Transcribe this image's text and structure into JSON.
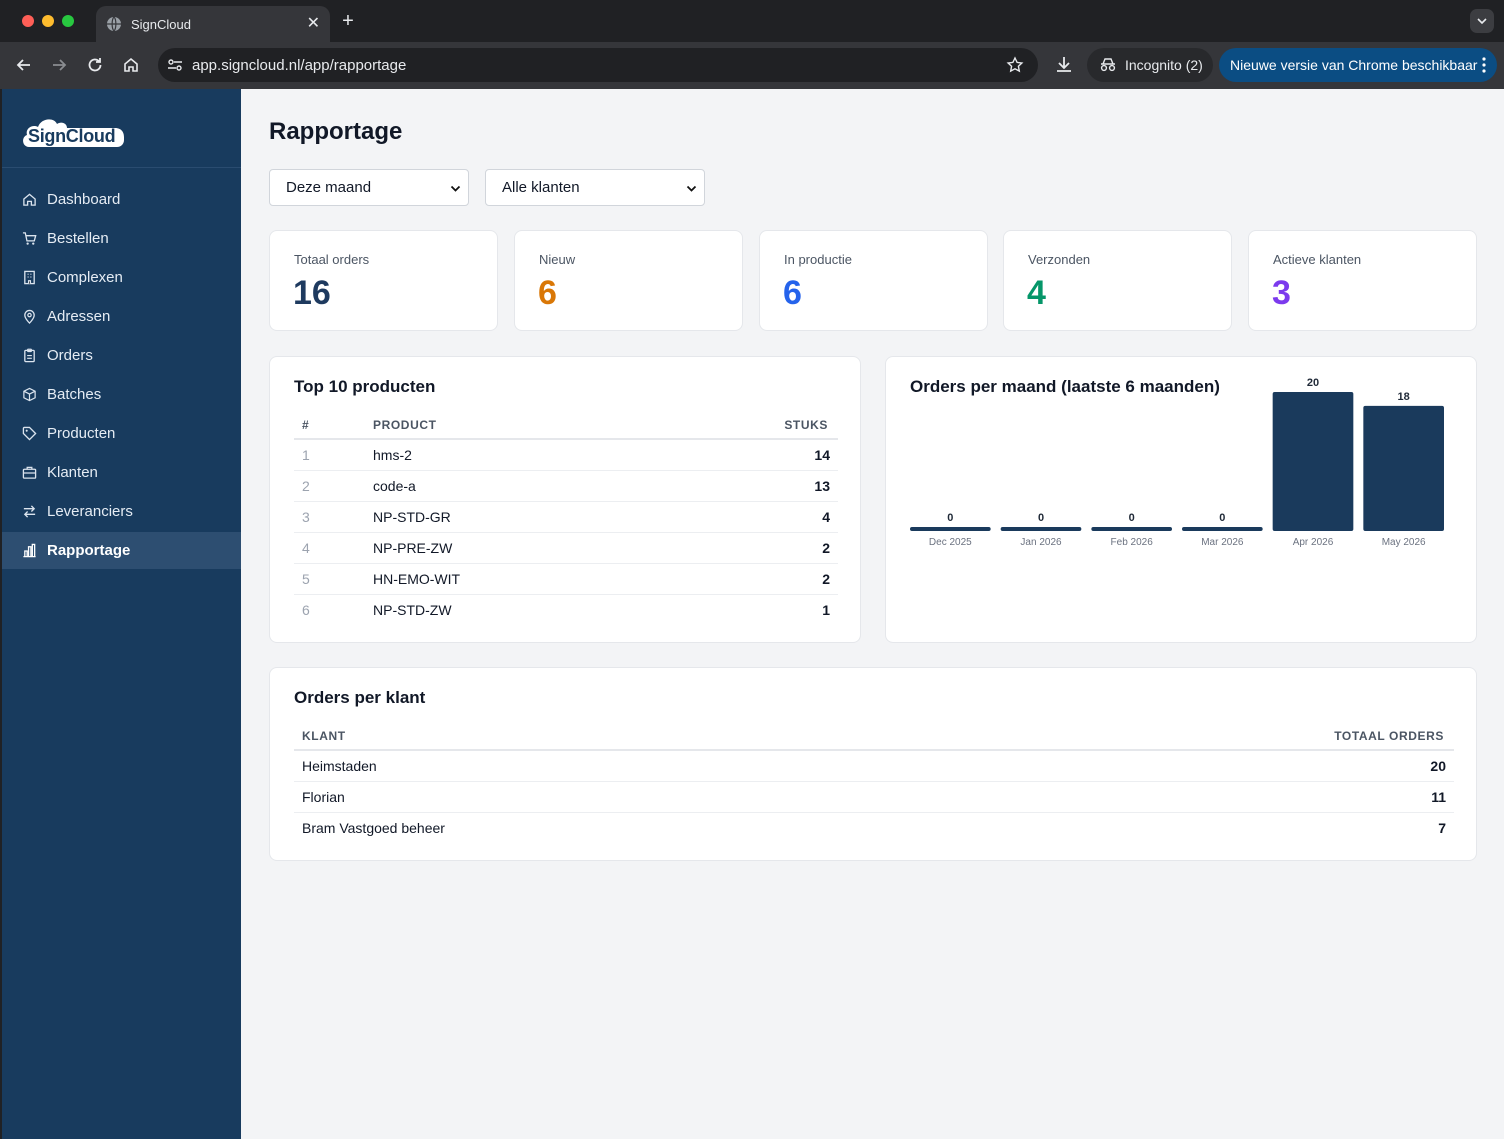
{
  "browser": {
    "tab_title": "SignCloud",
    "url": "app.signcloud.nl/app/rapportage",
    "incognito_label": "Incognito (2)",
    "update_label": "Nieuwe versie van Chrome beschikbaar"
  },
  "sidebar": {
    "logo_text": "SignCloud",
    "items": [
      {
        "label": "Dashboard",
        "icon": "home-icon"
      },
      {
        "label": "Bestellen",
        "icon": "cart-icon"
      },
      {
        "label": "Complexen",
        "icon": "building-icon"
      },
      {
        "label": "Adressen",
        "icon": "map-pin-icon"
      },
      {
        "label": "Orders",
        "icon": "clipboard-icon"
      },
      {
        "label": "Batches",
        "icon": "box-icon"
      },
      {
        "label": "Producten",
        "icon": "tag-icon"
      },
      {
        "label": "Klanten",
        "icon": "briefcase-icon"
      },
      {
        "label": "Leveranciers",
        "icon": "swap-icon"
      },
      {
        "label": "Rapportage",
        "icon": "bar-chart-icon"
      }
    ],
    "active": "Rapportage"
  },
  "page": {
    "title": "Rapportage",
    "filters": {
      "period": "Deze maand",
      "customer": "Alle klanten"
    }
  },
  "stats": [
    {
      "label": "Totaal orders",
      "value": "16",
      "color": "#1e3a5f"
    },
    {
      "label": "Nieuw",
      "value": "6",
      "color": "#d97706"
    },
    {
      "label": "In productie",
      "value": "6",
      "color": "#2563eb"
    },
    {
      "label": "Verzonden",
      "value": "4",
      "color": "#059669"
    },
    {
      "label": "Actieve klanten",
      "value": "3",
      "color": "#7c3aed"
    }
  ],
  "top_products": {
    "title": "Top 10 producten",
    "headers": {
      "rank": "#",
      "product": "PRODUCT",
      "qty": "STUKS"
    },
    "rows": [
      {
        "rank": "1",
        "product": "hms-2",
        "qty": "14"
      },
      {
        "rank": "2",
        "product": "code-a",
        "qty": "13"
      },
      {
        "rank": "3",
        "product": "NP-STD-GR",
        "qty": "4"
      },
      {
        "rank": "4",
        "product": "NP-PRE-ZW",
        "qty": "2"
      },
      {
        "rank": "5",
        "product": "HN-EMO-WIT",
        "qty": "2"
      },
      {
        "rank": "6",
        "product": "NP-STD-ZW",
        "qty": "1"
      }
    ]
  },
  "orders_per_month": {
    "title": "Orders per maand (laatste 6 maanden)"
  },
  "chart_data": {
    "type": "bar",
    "title": "Orders per maand (laatste 6 maanden)",
    "categories": [
      "Dec 2025",
      "Jan 2026",
      "Feb 2026",
      "Mar 2026",
      "Apr 2026",
      "May 2026"
    ],
    "values": [
      0,
      0,
      0,
      0,
      20,
      18
    ],
    "xlabel": "",
    "ylabel": "",
    "ylim": [
      0,
      20
    ],
    "grid": false,
    "bar_color": "#1a3a5c"
  },
  "orders_per_customer": {
    "title": "Orders per klant",
    "headers": {
      "customer": "KLANT",
      "total": "TOTAAL ORDERS"
    },
    "rows": [
      {
        "customer": "Heimstaden",
        "total": "20"
      },
      {
        "customer": "Florian",
        "total": "11"
      },
      {
        "customer": "Bram Vastgoed beheer",
        "total": "7"
      }
    ]
  }
}
